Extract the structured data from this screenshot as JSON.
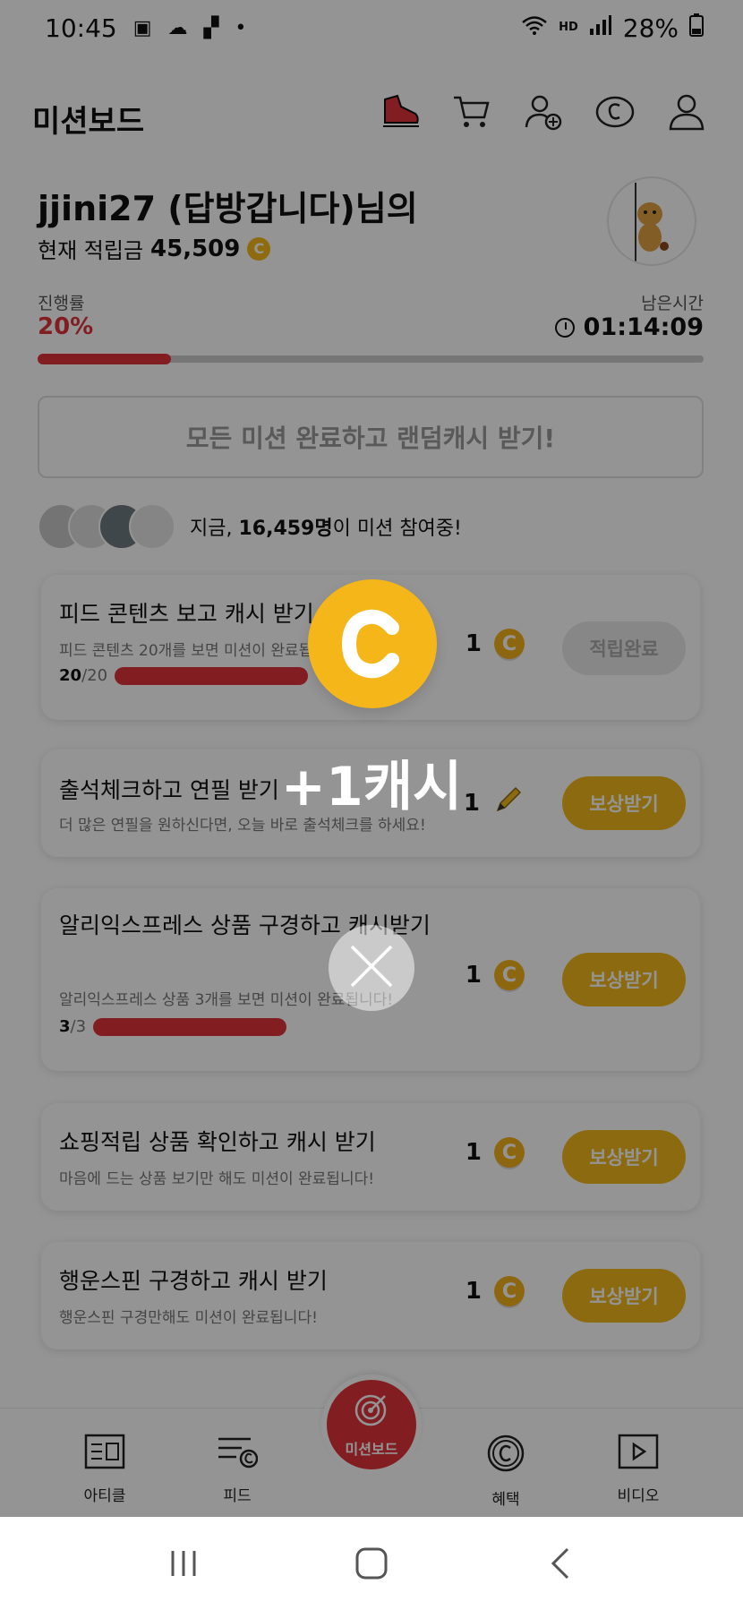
{
  "status": {
    "time": "10:45",
    "battery": "28%",
    "hd": "HD"
  },
  "header": {
    "title": "미션보드"
  },
  "user": {
    "greeting": "jjini27 (답방갑니다)님의",
    "balance_label": "현재 적립금",
    "balance": "45,509"
  },
  "progress": {
    "label": "진행률",
    "value": "20%",
    "fraction": 0.2,
    "time_label": "남은시간",
    "time_remaining": "01:14:09"
  },
  "complete_all": {
    "label": "모든 미션 완료하고 랜덤캐시 받기!"
  },
  "participants": {
    "prefix": "지금, ",
    "count": "16,459명",
    "suffix": "이 미션 참여중!"
  },
  "missions": [
    {
      "title": "피드 콘텐츠 보고 캐시 받기",
      "subtitle": "피드 콘텐츠 20개를 보면 미션이 완료됩니다!",
      "done": "20",
      "total": "/20",
      "reward": "1",
      "button": "적립완료"
    },
    {
      "title": "출석체크하고 연필 받기",
      "subtitle": "더 많은 연필을 원하신다면, 오늘 바로 출석체크를 하세요!",
      "reward": "1",
      "button": "보상받기"
    },
    {
      "title": "알리익스프레스 상품 구경하고 캐시받기",
      "subtitle": "알리익스프레스 상품 3개를 보면 미션이 완료됩니다!",
      "done": "3",
      "total": "/3",
      "reward": "1",
      "button": "보상받기"
    },
    {
      "title": "쇼핑적립 상품 확인하고 캐시 받기",
      "subtitle": "마음에 드는 상품 보기만 해도 미션이 완료됩니다!",
      "reward": "1",
      "button": "보상받기"
    },
    {
      "title": "행운스핀 구경하고 캐시 받기",
      "subtitle": "행운스핀 구경만해도 미션이 완료됩니다!",
      "reward": "1",
      "button": "보상받기"
    }
  ],
  "nav": {
    "article": "아티클",
    "feed": "피드",
    "mission": "미션보드",
    "benefit": "혜택",
    "video": "비디오"
  },
  "popup": {
    "text": "+1캐시"
  },
  "colors": {
    "accent": "#e0353b",
    "coin": "#f5b61a"
  }
}
